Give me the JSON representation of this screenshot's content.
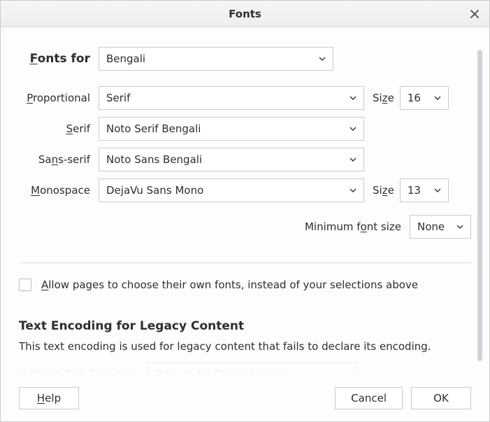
{
  "title": "Fonts",
  "labels": {
    "fonts_for": "Fonts for",
    "proportional": "Proportional",
    "serif": "Serif",
    "sans_serif": "Sans-serif",
    "monospace": "Monospace",
    "size": "Size",
    "min_font_size": "Minimum font size",
    "allow_pages": "Allow pages to choose their own fonts, instead of your selections above",
    "section_encoding": "Text Encoding for Legacy Content",
    "encoding_desc": "This text encoding is used for legacy content that fails to declare its encoding.",
    "fallback_encoding": "Fallback Text Encoding"
  },
  "mnemonic": {
    "fonts_for": "F",
    "proportional": "P",
    "serif": "S",
    "sans_serif": "n",
    "monospace": "M",
    "size_prop": "z",
    "size_mono": "z",
    "min_font_size_o": "o",
    "allow": "A",
    "help": "H"
  },
  "values": {
    "fonts_for": "Bengali",
    "proportional": "Serif",
    "serif_font": "Noto Serif Bengali",
    "sans_font": "Noto Sans Bengali",
    "mono_font": "DejaVu Sans Mono",
    "prop_size": "16",
    "mono_size": "13",
    "min_size": "None",
    "fallback_encoding": "Default for Current Locale",
    "allow_pages_checked": false
  },
  "buttons": {
    "help": "Help",
    "cancel": "Cancel",
    "ok": "OK"
  }
}
